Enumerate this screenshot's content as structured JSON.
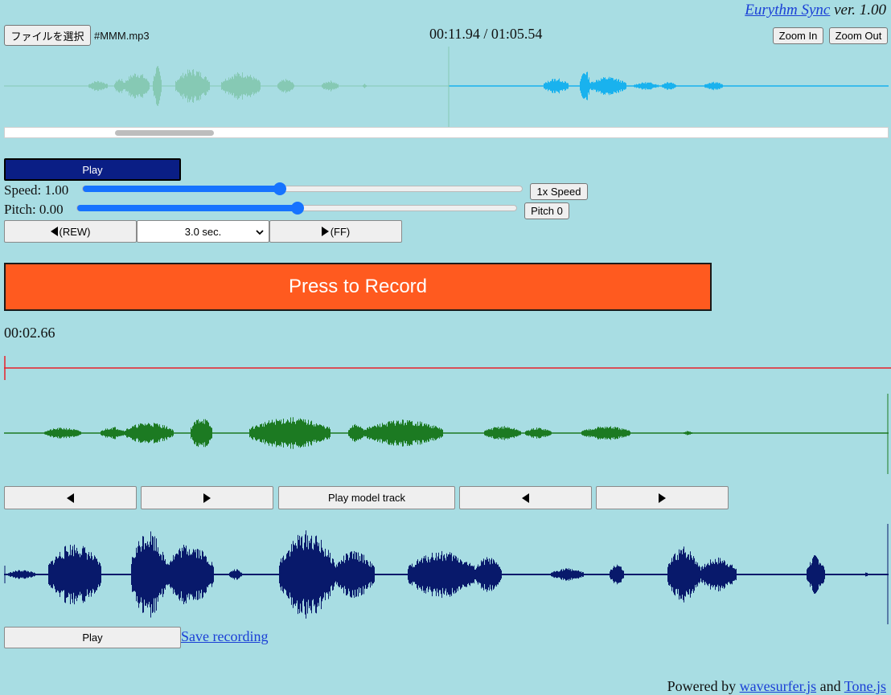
{
  "header": {
    "app_link": "Eurythm Sync",
    "version": "ver. 1.00"
  },
  "file": {
    "choose_button": "ファイルを選択",
    "filename": "#MMM.mp3"
  },
  "player": {
    "time_display": "00:11.94 / 01:05.54",
    "zoom_in": "Zoom In",
    "zoom_out": "Zoom Out",
    "play_label": "Play",
    "progress_fraction": 0.182,
    "scroll_fraction": 0.125,
    "speed_label": "Speed: 1.00",
    "speed_value": 1.0,
    "speed_reset": "1x Speed",
    "pitch_label": "Pitch: 0.00",
    "pitch_value": 0.0,
    "pitch_reset": "Pitch 0",
    "rew_label": "(REW)",
    "skip_selected": "3.0 sec.",
    "ff_label": "(FF)"
  },
  "record": {
    "button_label": "Press to Record",
    "elapsed": "00:02.66"
  },
  "model_controls": {
    "play_model_track": "Play model track"
  },
  "recording_controls": {
    "play_label": "Play",
    "save_link": "Save recording"
  },
  "footer": {
    "powered_by": "Powered by",
    "wavesurfer_link": "wavesurfer.js",
    "and_text": "and",
    "tone_link": "Tone.js"
  },
  "colors": {
    "background": "#a8dde3",
    "played_wave": "#86c9b4",
    "unplayed_wave": "#19b2ee",
    "model_wave": "#1c7a22",
    "recorded_wave": "#08196b",
    "record_button": "#ff5a1f",
    "play_button": "#0a1e85",
    "slider": "#1673ff",
    "cursor_line": "#e8202b"
  }
}
